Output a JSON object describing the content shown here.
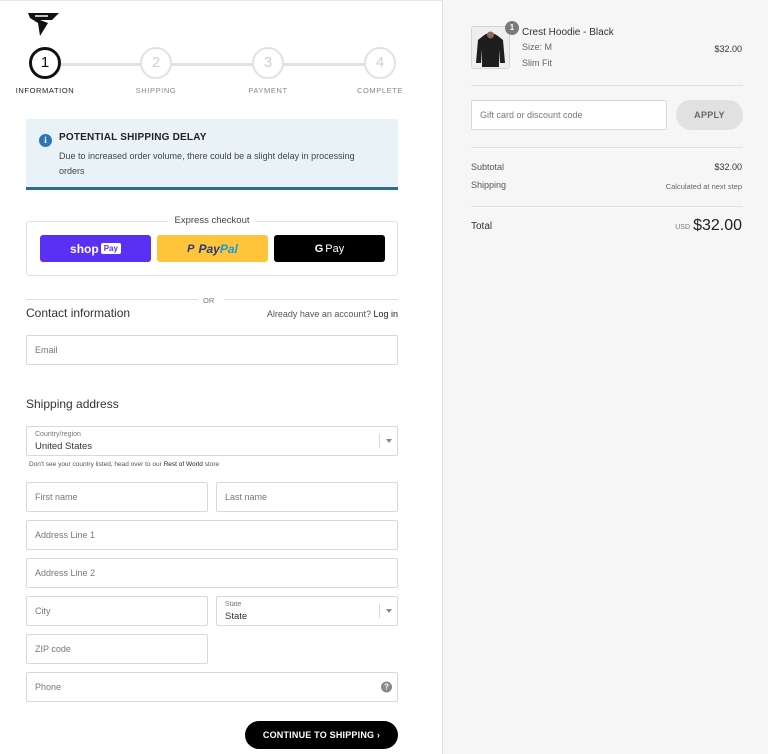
{
  "steps": [
    {
      "number": "1",
      "label": "INFORMATION"
    },
    {
      "number": "2",
      "label": "SHIPPING"
    },
    {
      "number": "3",
      "label": "PAYMENT"
    },
    {
      "number": "4",
      "label": "COMPLETE"
    }
  ],
  "notice": {
    "title": "POTENTIAL SHIPPING DELAY",
    "text": "Due to increased order volume, there could be a slight delay in processing orders",
    "icon": "info-icon"
  },
  "express": {
    "label": "Express checkout",
    "shop_label": "shop",
    "shop_tag": "Pay",
    "paypal_a": "Pay",
    "paypal_b": "Pal",
    "gpay_g": "G",
    "gpay_label": "Pay"
  },
  "or_text": "OR",
  "contact": {
    "title": "Contact information",
    "account_prompt": "Already have an account?",
    "login_label": "Log in",
    "email_placeholder": "Email"
  },
  "shipping": {
    "title": "Shipping address",
    "country_label": "Country/region",
    "country_value": "United States",
    "country_note_prefix": "Don't see your country listed, head over to our",
    "country_note_link": "Rest of World",
    "country_note_suffix": "store",
    "first_name": "First name",
    "last_name": "Last name",
    "address1": "Address Line 1",
    "address2": "Address Line 2",
    "city": "City",
    "state_label": "State",
    "state_value": "State",
    "zip": "ZIP code",
    "phone": "Phone",
    "help": "?"
  },
  "continue_label": "CONTINUE TO SHIPPING ›",
  "cart": {
    "qty": "1",
    "product_name": "Crest Hoodie - Black",
    "size": "Size: M",
    "fit": "Slim Fit",
    "price": "$32.00"
  },
  "discount": {
    "placeholder": "Gift card or discount code",
    "apply_label": "APPLY"
  },
  "summary": {
    "subtotal_label": "Subtotal",
    "subtotal_value": "$32.00",
    "shipping_label": "Shipping",
    "shipping_value": "Calculated at next step",
    "total_label": "Total",
    "currency": "USD",
    "total_value": "$32.00"
  },
  "colors": {
    "notice_bg": "#e8f2f7",
    "notice_border": "#2a6c9c",
    "shop_pay": "#5a31f4",
    "paypal": "#ffc439",
    "gpay": "#000000"
  }
}
